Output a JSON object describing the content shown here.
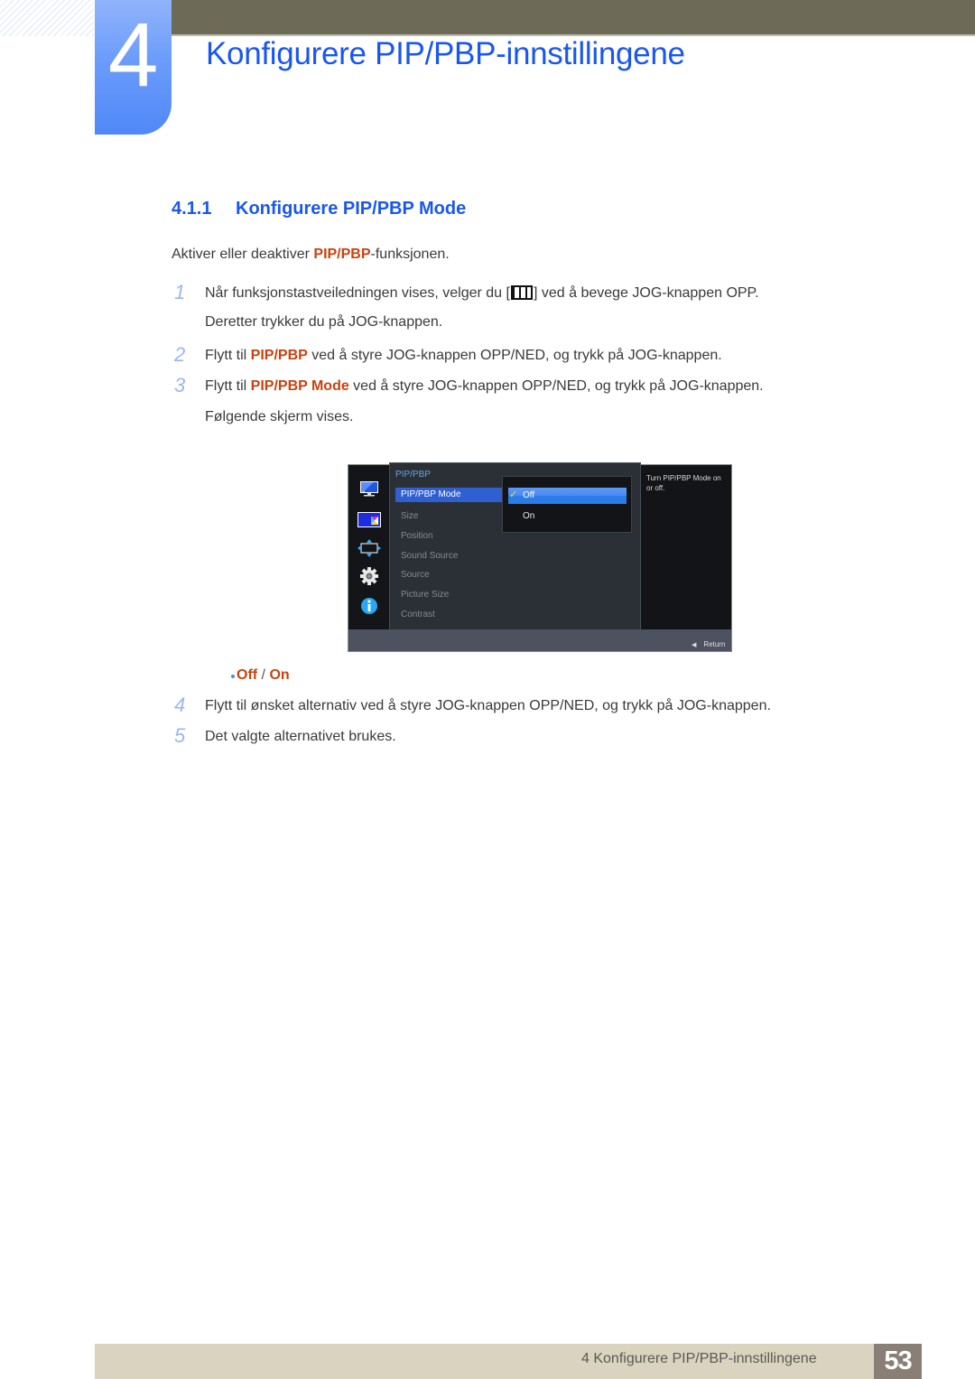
{
  "chapter": {
    "number": "4",
    "title": "Konfigurere PIP/PBP-innstillingene"
  },
  "section": {
    "number": "4.1.1",
    "title": "Konfigurere PIP/PBP Mode"
  },
  "intro": {
    "before": "Aktiver eller deaktiver ",
    "highlight": "PIP/PBP",
    "after": "-funksjonen."
  },
  "steps": [
    {
      "number": "1",
      "line1_before": "Når funksjonstastveiledningen vises, velger du [",
      "icon": "menu-icon",
      "line1_after": "] ved å bevege JOG-knappen OPP.",
      "line2": "Deretter trykker du på JOG-knappen."
    },
    {
      "number": "2",
      "before": "Flytt til ",
      "highlight": "PIP/PBP",
      "after": " ved å styre JOG-knappen OPP/NED, og trykk på JOG-knappen."
    },
    {
      "number": "3",
      "before": "Flytt til ",
      "highlight": "PIP/PBP Mode",
      "after": " ved å styre JOG-knappen OPP/NED, og trykk på JOG-knappen.",
      "line2": "Følgende skjerm vises."
    },
    {
      "number": "4",
      "text": "Flytt til ønsket alternativ ved å styre JOG-knappen OPP/NED, og trykk på JOG-knappen."
    },
    {
      "number": "5",
      "text": "Det valgte alternativet brukes."
    }
  ],
  "osd": {
    "side_icons": [
      "monitor-icon",
      "pip-pbp-icon",
      "position-arrows-icon",
      "gear-icon",
      "info-icon"
    ],
    "category": "PIP/PBP",
    "menu_items": [
      "PIP/PBP Mode",
      "Size",
      "Position",
      "Sound Source",
      "Source",
      "Picture Size",
      "Contrast"
    ],
    "selected_item": "PIP/PBP Mode",
    "options": [
      "Off",
      "On"
    ],
    "selected_option": "Off",
    "help_text": "Turn PIP/PBP Mode on or off.",
    "return_label": "Return"
  },
  "options_bullet": {
    "off": "Off",
    "separator": " / ",
    "on": "On"
  },
  "footer": {
    "text": "4 Konfigurere PIP/PBP-innstillingene",
    "page": "53"
  },
  "colors": {
    "accent_blue": "#1a57f0",
    "highlight_orange": "#c9420f",
    "header_bar": "#6d6b58",
    "footer_bar": "#d9d3c0",
    "page_box": "#8a7f76"
  }
}
